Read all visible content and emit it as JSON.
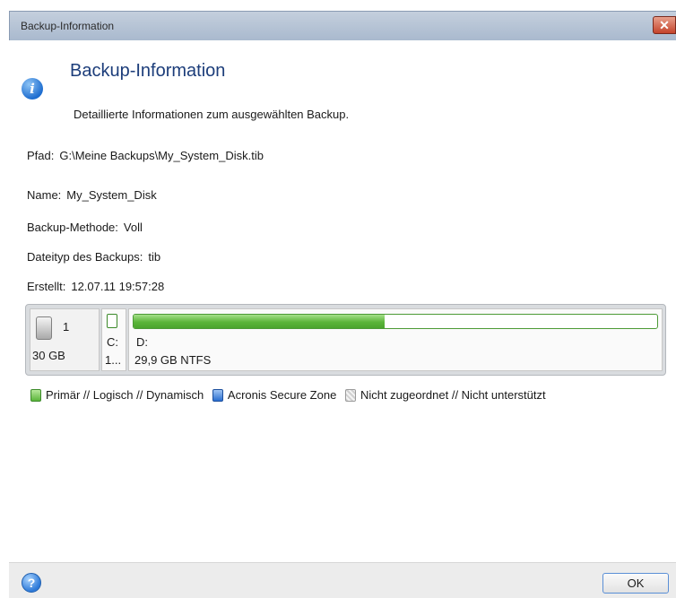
{
  "window": {
    "title": "Backup-Information",
    "close_label": "✕"
  },
  "header": {
    "icon": "info-icon",
    "title": "Backup-Information",
    "subtitle": "Detaillierte Informationen zum ausgewählten Backup."
  },
  "details": {
    "path_label": "Pfad:",
    "path_value": "G:\\Meine Backups\\My_System_Disk.tib",
    "name_label": "Name:",
    "name_value": "My_System_Disk",
    "method_label": "Backup-Methode:",
    "method_value": "Voll",
    "filetype_label": "Dateityp des Backups:",
    "filetype_value": "tib",
    "created_label": "Erstellt:",
    "created_value": "12.07.11 19:57:28"
  },
  "disk": {
    "icon": "hard-drive-icon",
    "number": "1",
    "size": "30 GB",
    "partitions": [
      {
        "letter": "C:",
        "size": "1..."
      },
      {
        "letter": "D:",
        "info": "29,9 GB  NTFS",
        "used_fraction": 0.48
      }
    ]
  },
  "legend": {
    "items": [
      {
        "label": "Primär // Logisch // Dynamisch",
        "color": "#5bb53a"
      },
      {
        "label": "Acronis Secure Zone",
        "color": "#2a6ed0"
      },
      {
        "label": "Nicht zugeordnet // Nicht unterstützt",
        "color": "#d0d0d0"
      }
    ]
  },
  "footer": {
    "help_icon": "help-icon",
    "help_glyph": "?",
    "ok_label": "OK"
  }
}
